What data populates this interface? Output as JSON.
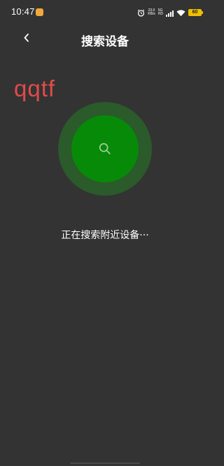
{
  "status_bar": {
    "time": "10:47",
    "net_speed_value": "23.0",
    "net_speed_unit": "KB/s",
    "signal_type_top": "5G",
    "signal_type_bottom": "HD",
    "battery_level": "60"
  },
  "header": {
    "title": "搜索设备",
    "back_icon": "chevron-left-icon"
  },
  "watermark": "qqtf",
  "search": {
    "icon": "search-icon",
    "status_text": "正在搜索附近设备···"
  },
  "colors": {
    "background": "#333333",
    "pulse_outer": "#2b5a2b",
    "pulse_inner": "#078a07",
    "watermark": "#e14b4b",
    "battery": "#f0c000"
  }
}
